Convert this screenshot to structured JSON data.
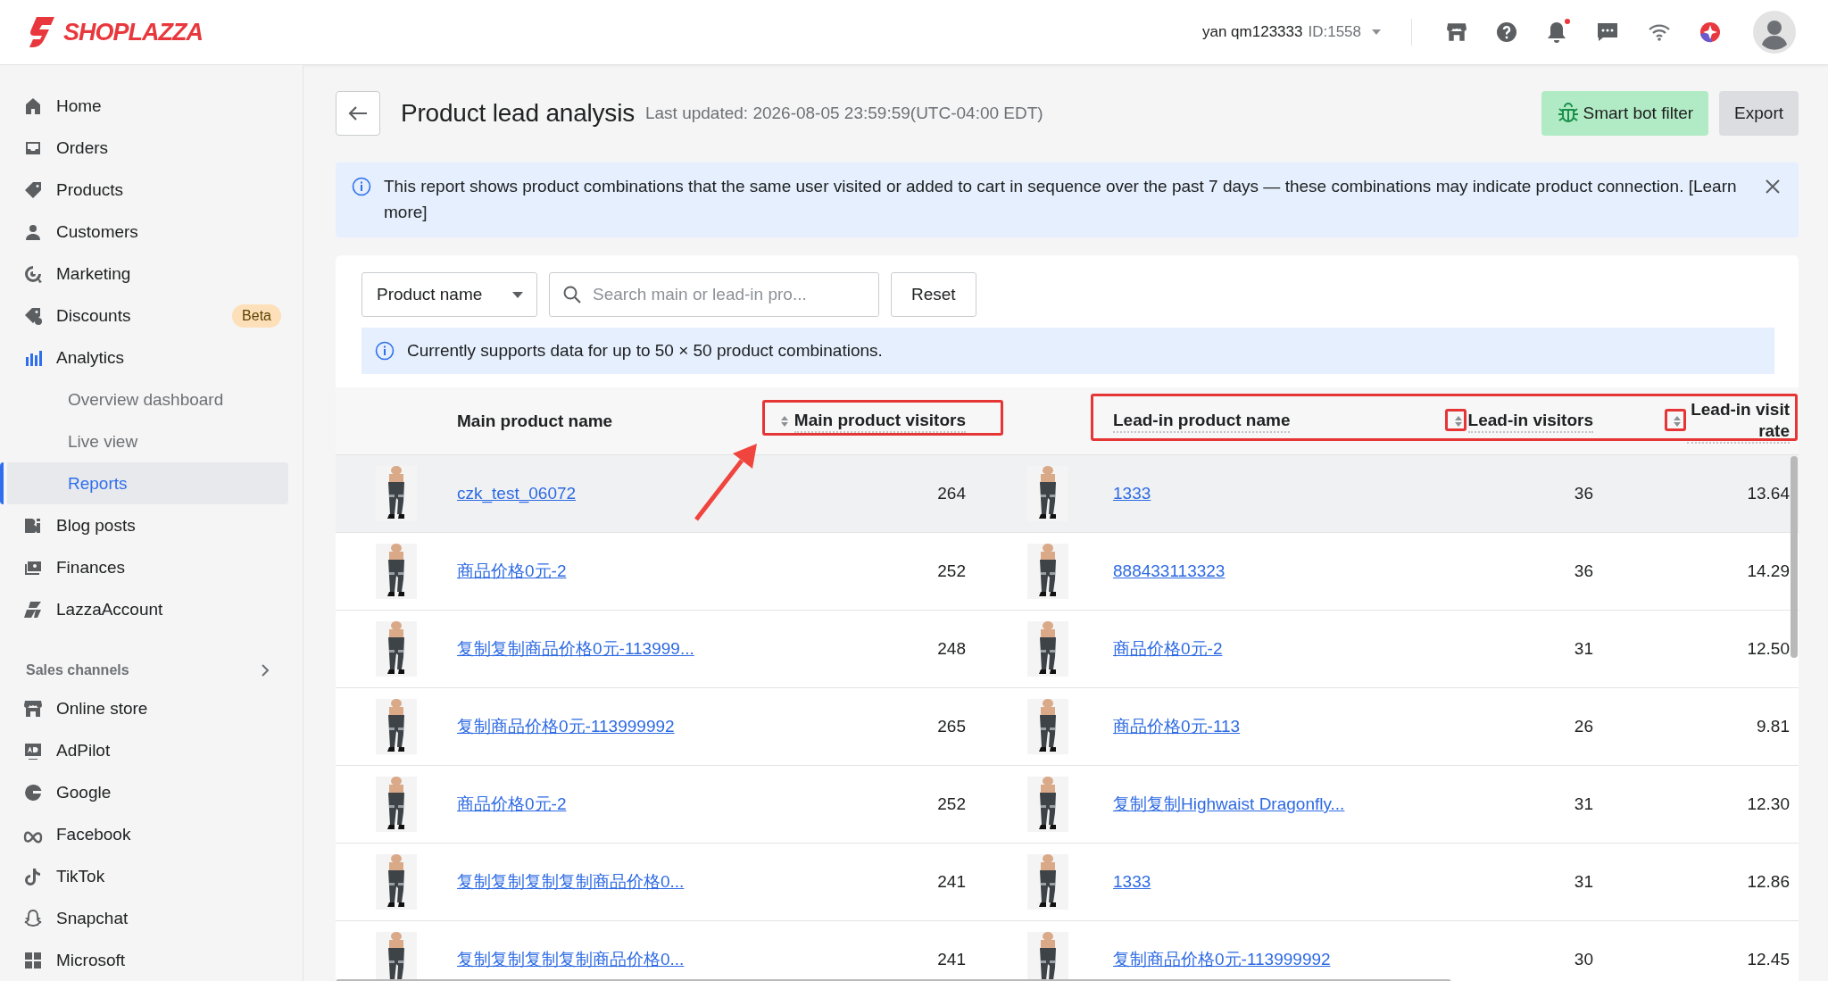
{
  "topbar": {
    "logo": "SHOPLAZZA",
    "account": "yan qm123333",
    "account_id": "ID:1558",
    "has_notification": true
  },
  "sidebar": {
    "items": [
      {
        "label": "Home",
        "selected": false
      },
      {
        "label": "Orders",
        "selected": false
      },
      {
        "label": "Products",
        "selected": false
      },
      {
        "label": "Customers",
        "selected": false
      },
      {
        "label": "Marketing",
        "selected": false
      },
      {
        "label": "Discounts",
        "selected": false,
        "badge": "Beta"
      },
      {
        "label": "Analytics",
        "selected": false,
        "children": [
          {
            "label": "Overview dashboard",
            "selected": false
          },
          {
            "label": "Live view",
            "selected": false
          },
          {
            "label": "Reports",
            "selected": true
          }
        ]
      },
      {
        "label": "Blog posts",
        "selected": false
      },
      {
        "label": "Finances",
        "selected": false
      },
      {
        "label": "LazzaAccount",
        "selected": false
      }
    ],
    "sales_channels": {
      "title": "Sales channels",
      "items": [
        {
          "label": "Online store",
          "selected": false
        },
        {
          "label": "AdPilot",
          "selected": false
        },
        {
          "label": "Google",
          "selected": false
        },
        {
          "label": "Facebook",
          "selected": false
        },
        {
          "label": "TikTok",
          "selected": false
        },
        {
          "label": "Snapchat",
          "selected": false
        },
        {
          "label": "Microsoft",
          "selected": false
        }
      ]
    }
  },
  "page": {
    "title": "Product lead analysis",
    "last_updated": "Last updated: 2026-08-05 23:59:59(UTC-04:00 EDT)",
    "buttons": [
      "Smart bot filter",
      "Export"
    ],
    "banner": "This report shows product combinations that the same user visited or added to cart in sequence over the past 7 days — these combinations may indicate product connection. [Learn more]",
    "filter": {
      "dropdown": "Product name",
      "search_placeholder": "Search main or lead-in pro...",
      "reset": "Reset"
    },
    "notice": "Currently supports data for up to 50 × 50 product combinations."
  },
  "table": {
    "columns": [
      {
        "label": "Main product name",
        "sortable": false,
        "has_tooltip": false
      },
      {
        "label": "Main product visitors",
        "sortable": true,
        "has_tooltip": true
      },
      {
        "label": "Lead-in product name",
        "sortable": false,
        "has_tooltip": true
      },
      {
        "label": "Lead-in visitors",
        "sortable": true,
        "has_tooltip": true
      },
      {
        "label": "Lead-in visit rate",
        "sortable": true,
        "has_tooltip": true
      }
    ],
    "rows": [
      {
        "main_product": "czk_test_06072",
        "main_visitors": "264",
        "lead_product": "1333",
        "lead_visitors": "36",
        "visit_rate": "13.64",
        "hovered": true
      },
      {
        "main_product": "商品价格0元-2",
        "main_visitors": "252",
        "lead_product": "888433113323",
        "lead_visitors": "36",
        "visit_rate": "14.29",
        "hovered": false
      },
      {
        "main_product": "复制复制商品价格0元-113999...",
        "main_visitors": "248",
        "lead_product": "商品价格0元-2",
        "lead_visitors": "31",
        "visit_rate": "12.50",
        "hovered": false
      },
      {
        "main_product": "复制商品价格0元-113999992",
        "main_visitors": "265",
        "lead_product": "商品价格0元-113",
        "lead_visitors": "26",
        "visit_rate": "9.81",
        "hovered": false
      },
      {
        "main_product": "商品价格0元-2",
        "main_visitors": "252",
        "lead_product": "复制复制Highwaist Dragonfly...",
        "lead_visitors": "31",
        "visit_rate": "12.30",
        "hovered": false
      },
      {
        "main_product": "复制复制复制复制商品价格0...",
        "main_visitors": "241",
        "lead_product": "1333",
        "lead_visitors": "31",
        "visit_rate": "12.86",
        "hovered": false
      },
      {
        "main_product": "复制复制复制复制商品价格0...",
        "main_visitors": "241",
        "lead_product": "复制商品价格0元-113999992",
        "lead_visitors": "30",
        "visit_rate": "12.45",
        "hovered": false
      }
    ]
  }
}
